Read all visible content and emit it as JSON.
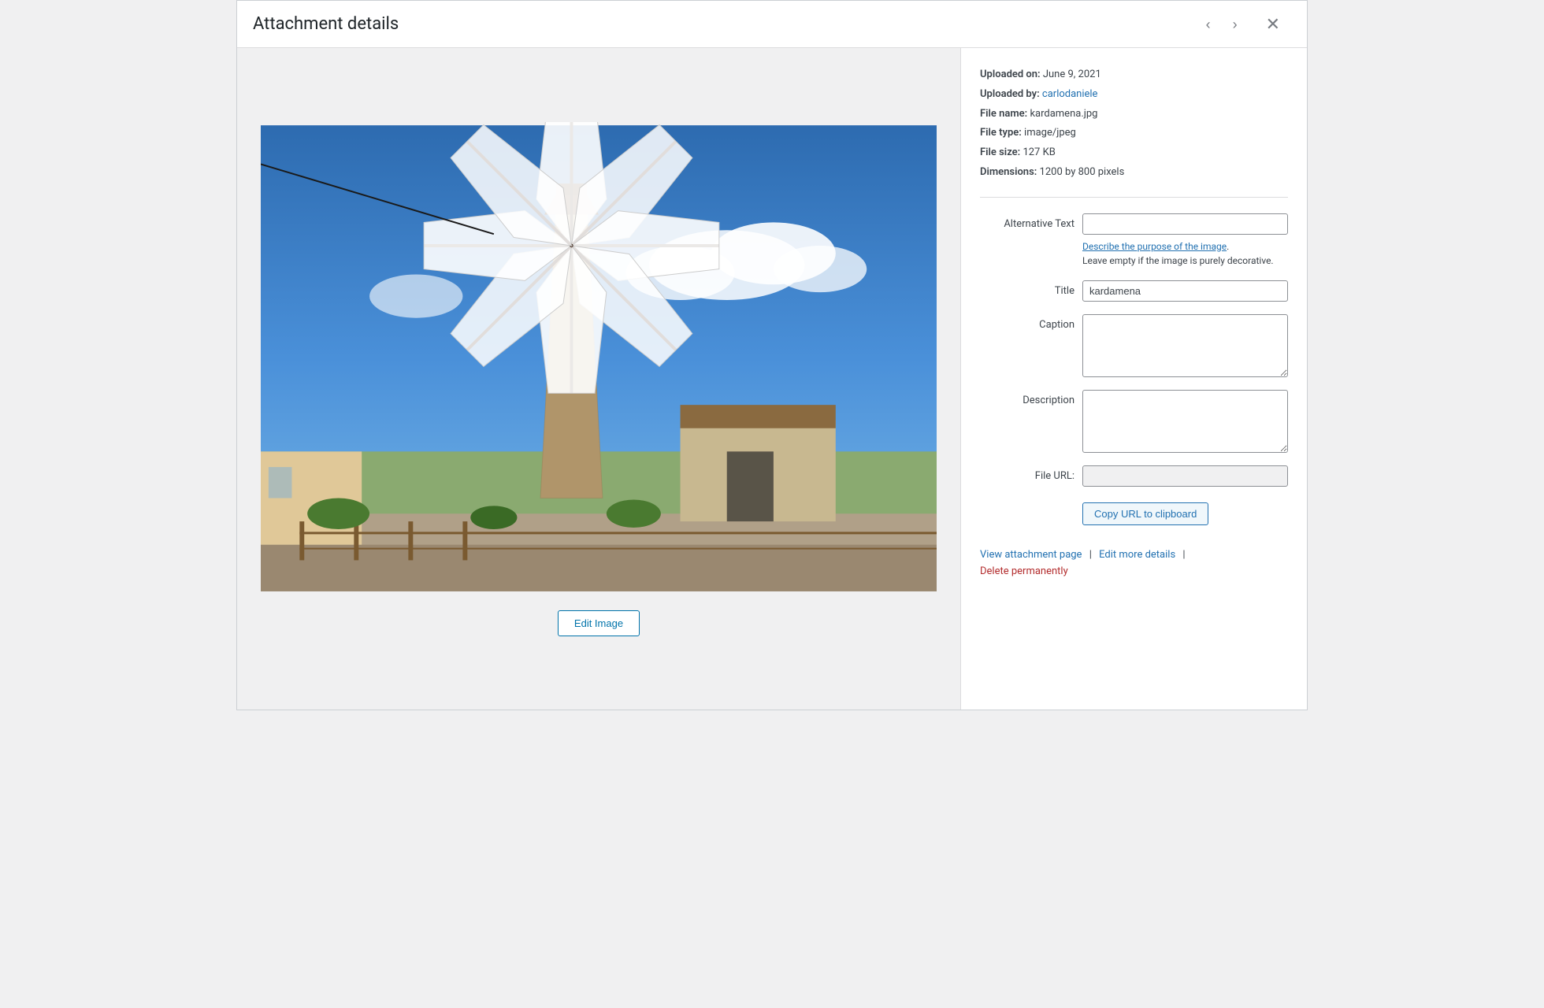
{
  "header": {
    "title": "Attachment details",
    "prev_label": "‹",
    "next_label": "›",
    "close_label": "✕"
  },
  "file_info": {
    "uploaded_on_label": "Uploaded on:",
    "uploaded_on_value": "June 9, 2021",
    "uploaded_by_label": "Uploaded by:",
    "uploaded_by_value": "carlodaniele",
    "uploaded_by_link": "#",
    "file_name_label": "File name:",
    "file_name_value": "kardamena.jpg",
    "file_type_label": "File type:",
    "file_type_value": "image/jpeg",
    "file_size_label": "File size:",
    "file_size_value": "127 KB",
    "dimensions_label": "Dimensions:",
    "dimensions_value": "1200 by 800 pixels"
  },
  "form": {
    "alt_text_label": "Alternative Text",
    "alt_text_value": "",
    "alt_text_placeholder": "",
    "alt_text_hint_link": "Describe the purpose of the image",
    "alt_text_hint_text": "Leave empty if the image is purely decorative.",
    "title_label": "Title",
    "title_value": "kardamena",
    "caption_label": "Caption",
    "caption_value": "",
    "description_label": "Description",
    "description_value": "",
    "file_url_label": "File URL:",
    "file_url_value": ""
  },
  "buttons": {
    "edit_image": "Edit Image",
    "copy_url": "Copy URL to clipboard"
  },
  "footer": {
    "view_page_label": "View attachment page",
    "view_page_link": "#",
    "edit_details_label": "Edit more details",
    "edit_details_link": "#",
    "delete_label": "Delete permanently",
    "delete_link": "#"
  }
}
